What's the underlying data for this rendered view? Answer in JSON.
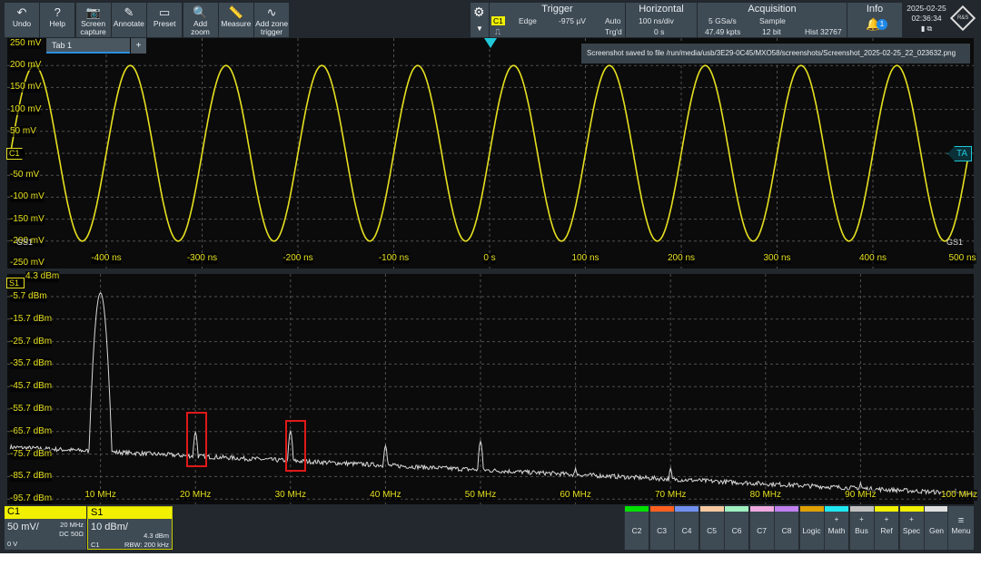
{
  "toolbar": {
    "buttons": [
      {
        "label": "Undo",
        "icon": "undo-icon",
        "glyph": "↶"
      },
      {
        "label": "Help",
        "icon": "help-icon",
        "glyph": "?"
      },
      {
        "label": "Screen capture",
        "icon": "camera-icon",
        "glyph": "📷"
      },
      {
        "label": "Annotate",
        "icon": "pencil-icon",
        "glyph": "✎"
      },
      {
        "label": "Preset",
        "icon": "preset-icon",
        "glyph": "▭"
      },
      {
        "label": "Add zoom",
        "icon": "zoom-icon",
        "glyph": "🔍"
      },
      {
        "label": "Measure",
        "icon": "ruler-icon",
        "glyph": "📏"
      },
      {
        "label": "Add zone trigger",
        "icon": "zone-trigger-icon",
        "glyph": "∿"
      }
    ]
  },
  "trigger": {
    "title": "Trigger",
    "source": "C1",
    "type": "Edge",
    "level": "-975 µV",
    "mode": "Auto",
    "state": "Trg'd"
  },
  "horizontal": {
    "title": "Horizontal",
    "scale": "100 ns/div",
    "position": "0 s"
  },
  "acquisition": {
    "title": "Acquisition",
    "rate": "5 GSa/s",
    "mode": "Sample",
    "points": "47.49 kpts",
    "resolution": "12 bit",
    "hist": "Hist 32767"
  },
  "info": {
    "title": "Info",
    "notifications": "1"
  },
  "clock": {
    "date": "2025-02-25",
    "time": "02:36:34"
  },
  "logo": "R&S",
  "tab": {
    "label": "Tab 1",
    "add": "+"
  },
  "notification": "Screenshot saved to file /run/media/usb/3E29-0C45/MXO58/screenshots/Screenshot_2025-02-25_22_023632.png",
  "markers": {
    "channel": "C1",
    "trigger_arrow": "TA",
    "gs_left": "GS1",
    "gs_right": "GS1",
    "spectrum": "S1"
  },
  "colors": {
    "trace": "#e6e020",
    "spectrum": "#d8d8d8",
    "grid": "#505050",
    "accent": "#20c8d8",
    "highlight": "#e01818"
  },
  "chart_data": [
    {
      "type": "line",
      "title": "",
      "xlabel": "",
      "ylabel": "",
      "x_ticks": [
        "-400 ns",
        "-300 ns",
        "-200 ns",
        "-100 ns",
        "0 s",
        "100 ns",
        "200 ns",
        "300 ns",
        "400 ns",
        "500 ns"
      ],
      "y_ticks": [
        "250 mV",
        "200 mV",
        "150 mV",
        "100 mV",
        "50 mV",
        "-50 mV",
        "-100 mV",
        "-150 mV",
        "-200 mV",
        "-250 mV"
      ],
      "xlim_ns": [
        -500,
        500
      ],
      "ylim_mV": [
        -250,
        250
      ],
      "grid": true,
      "series": [
        {
          "signal": "sine",
          "frequency_MHz": 10,
          "amplitude_mV": 200,
          "offset_mV": 0
        }
      ]
    },
    {
      "type": "line",
      "title": "",
      "xlabel": "",
      "ylabel": "",
      "x_ticks": [
        "10 MHz",
        "20 MHz",
        "30 MHz",
        "40 MHz",
        "50 MHz",
        "60 MHz",
        "70 MHz",
        "80 MHz",
        "90 MHz",
        "100 MHz"
      ],
      "y_ticks": [
        "4.3 dBm",
        "-5.7 dBm",
        "-15.7 dBm",
        "-25.7 dBm",
        "-35.7 dBm",
        "-45.7 dBm",
        "-55.7 dBm",
        "-65.7 dBm",
        "-75.7 dBm",
        "-85.7 dBm",
        "-95.7 dBm"
      ],
      "xlim_MHz": [
        0,
        102
      ],
      "ylim_dBm": [
        -97,
        4.3
      ],
      "grid": true,
      "noise_floor_dBm": {
        "start": -72.5,
        "end": -93
      },
      "peaks": [
        {
          "f": 10,
          "dBm": -4
        },
        {
          "f": 20,
          "dBm": -66
        },
        {
          "f": 30,
          "dBm": -65.5
        },
        {
          "f": 40,
          "dBm": -72
        },
        {
          "f": 50,
          "dBm": -70
        },
        {
          "f": 60,
          "dBm": -82
        },
        {
          "f": 70,
          "dBm": -82
        },
        {
          "f": 90,
          "dBm": -88.5
        },
        {
          "f": 100,
          "dBm": -91.5
        }
      ],
      "highlighted_peaks_MHz": [
        20,
        30
      ]
    }
  ],
  "channels": {
    "c1": {
      "name": "C1",
      "scale": "50 mV/",
      "bw": "20 MHz",
      "coupling": "DC 50Ω",
      "offset": "0 V"
    },
    "s1": {
      "name": "S1",
      "scale": "10 dBm/",
      "ref": "4.3 dBm",
      "source": "C1",
      "rbw": "RBW: 200 kHz"
    }
  },
  "channel_buttons": [
    {
      "label": "C2",
      "color": "#00e000"
    },
    {
      "label": "C3",
      "color": "#ff6020"
    },
    {
      "label": "C4",
      "color": "#7090f0"
    },
    {
      "label": "C5",
      "color": "#f8c8a0"
    },
    {
      "label": "C6",
      "color": "#a0f0c0"
    },
    {
      "label": "C7",
      "color": "#f0a8e0"
    },
    {
      "label": "C8",
      "color": "#c080f0"
    },
    {
      "label": "Logic",
      "color": "#e0a000"
    },
    {
      "label": "Math",
      "color": "#20e8f0",
      "plus": "+"
    },
    {
      "label": "Bus",
      "color": "#c0c0c0",
      "plus": "+"
    },
    {
      "label": "Ref",
      "color": "#f0f000",
      "plus": "+"
    },
    {
      "label": "Spec",
      "color": "#f0f000",
      "plus": "+"
    },
    {
      "label": "Gen",
      "color": "#e0e0e0"
    }
  ],
  "menu": {
    "label": "Menu"
  }
}
